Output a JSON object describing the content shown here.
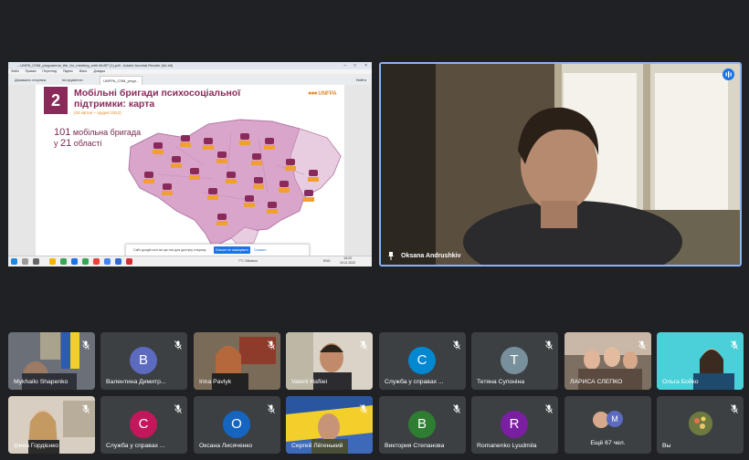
{
  "share": {
    "window_title": "...UNPA_CSM_programme_file_for_meeting_with MoSP (1).pdf - Adobe Acrobat Reader (64-bit)",
    "menu": [
      "Файл",
      "Правка",
      "Перегляд",
      "Підпис",
      "Вікно",
      "Довідка"
    ],
    "tabs": [
      "Домашня сторінка",
      "Інструменти",
      "UNFPA_CSM_progr..."
    ],
    "sign_in": "Увійти",
    "notification": {
      "text": "Сайт google.com ви ще ноч для доступу к екрану",
      "primary": "Більше не показувати",
      "secondary": "Сховати"
    },
    "taskbar": {
      "weather": "7°C Облачно",
      "lang": "ENG",
      "time": "16:03",
      "date": "19.11.2022"
    }
  },
  "slide": {
    "number": "2",
    "title_line1": "Мобільні бригади психосоціальної",
    "title_line2": "підтримки: карта",
    "date_range": "(03 квітня – грудня 2022)",
    "logo": "UNFPA",
    "count_line1_num": "101",
    "count_line1_text": "мобільна бригада",
    "count_line2_pre": "у",
    "count_line2_num": "21",
    "count_line2_text": "області"
  },
  "speaker": {
    "name": "Oksana Andrushkiv"
  },
  "participants": [
    {
      "name": "Mykhailo Shapenko",
      "type": "video",
      "scene": "flags"
    },
    {
      "name": "Валентина Димитр...",
      "type": "avatar",
      "initial": "В",
      "color": "#5c6bc0"
    },
    {
      "name": "Irina Pavlyk",
      "type": "video",
      "scene": "office"
    },
    {
      "name": "Valerii Hafiiei",
      "type": "video",
      "scene": "man"
    },
    {
      "name": "Служба у справах ...",
      "type": "avatar",
      "initial": "С",
      "color": "#0288d1"
    },
    {
      "name": "Тетяна Супоніна",
      "type": "avatar",
      "initial": "Т",
      "color": "#78909c"
    },
    {
      "name": "ЛАРИСА СЛЕПКО",
      "type": "video",
      "scene": "group"
    },
    {
      "name": "Ольга Бойко",
      "type": "video",
      "scene": "teal"
    },
    {
      "name": "Ірина Гордієнко",
      "type": "video",
      "scene": "woman"
    },
    {
      "name": "Служба у справах ...",
      "type": "avatar",
      "initial": "С",
      "color": "#c2185b"
    },
    {
      "name": "Оксана Лисяченко",
      "type": "avatar",
      "initial": "О",
      "color": "#1565c0"
    },
    {
      "name": "Сергей Лёгенький",
      "type": "video",
      "scene": "flagman"
    },
    {
      "name": "Виктория Степанова",
      "type": "avatar",
      "initial": "В",
      "color": "#2e7d32"
    },
    {
      "name": "Romanenko Lyudmila",
      "type": "avatar",
      "initial": "R",
      "color": "#7b1fa2"
    },
    {
      "name": "Ещё 67 чел.",
      "type": "more",
      "initial": "M",
      "color": "#5c6bc0"
    },
    {
      "name": "Вы",
      "type": "self"
    }
  ],
  "colors": {
    "background": "#202124",
    "tile": "#3c4043",
    "accent": "#8ab4f8",
    "slide_brand": "#8a2a5a",
    "slide_orange": "#e08a2b"
  }
}
